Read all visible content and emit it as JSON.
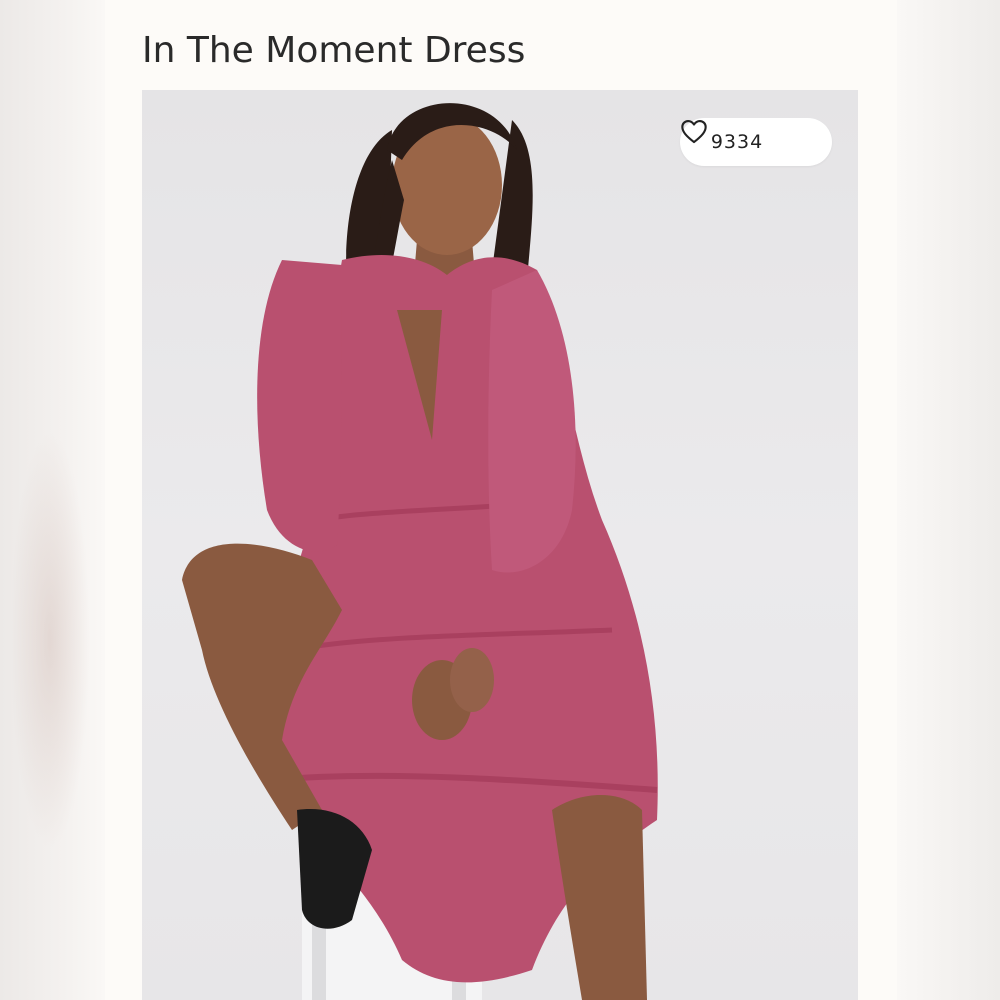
{
  "product": {
    "title": "In The Moment Dress",
    "likes": "9334"
  },
  "icons": {
    "like": "heart-outline-icon"
  },
  "colors": {
    "dress": "#b9506f",
    "background": "#fdfbf8",
    "photo_bg": "#e8e7e9"
  }
}
